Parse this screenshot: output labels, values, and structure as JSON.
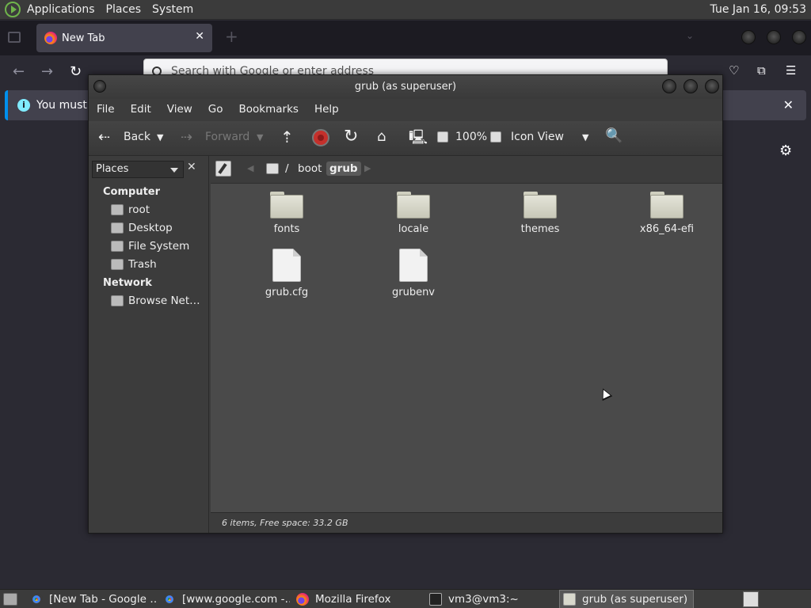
{
  "top_panel": {
    "menus": [
      "Applications",
      "Places",
      "System"
    ],
    "clock": "Tue Jan 16, 09:53"
  },
  "firefox": {
    "tab_label": "New Tab",
    "url_placeholder": "Search with Google or enter address",
    "notice_text": "You must lo"
  },
  "file_manager": {
    "title": "grub (as superuser)",
    "menus": [
      "File",
      "Edit",
      "View",
      "Go",
      "Bookmarks",
      "Help"
    ],
    "toolbar": {
      "back": "Back",
      "forward": "Forward",
      "zoom": "100%",
      "view_mode": "Icon View"
    },
    "sidebar": {
      "selector": "Places",
      "computer_heading": "Computer",
      "computer_items": [
        "root",
        "Desktop",
        "File System",
        "Trash"
      ],
      "network_heading": "Network",
      "network_items": [
        "Browse Net…"
      ]
    },
    "path": {
      "root_sep": "/",
      "segments": [
        "boot",
        "grub"
      ]
    },
    "items": [
      {
        "name": "fonts",
        "type": "folder"
      },
      {
        "name": "locale",
        "type": "folder"
      },
      {
        "name": "themes",
        "type": "folder"
      },
      {
        "name": "x86_64-efi",
        "type": "folder"
      },
      {
        "name": "grub.cfg",
        "type": "file"
      },
      {
        "name": "grubenv",
        "type": "file"
      }
    ],
    "status": "6 items, Free space: 33.2 GB"
  },
  "taskbar": {
    "tasks": [
      {
        "label": "[New Tab - Google …",
        "icon": "chrome-icon"
      },
      {
        "label": "[www.google.com -…",
        "icon": "chrome-icon"
      },
      {
        "label": "Mozilla Firefox",
        "icon": "firefox-icon"
      },
      {
        "label": "vm3@vm3:~",
        "icon": "terminal-icon"
      },
      {
        "label": "grub (as superuser)",
        "icon": "folder-icon"
      }
    ]
  }
}
